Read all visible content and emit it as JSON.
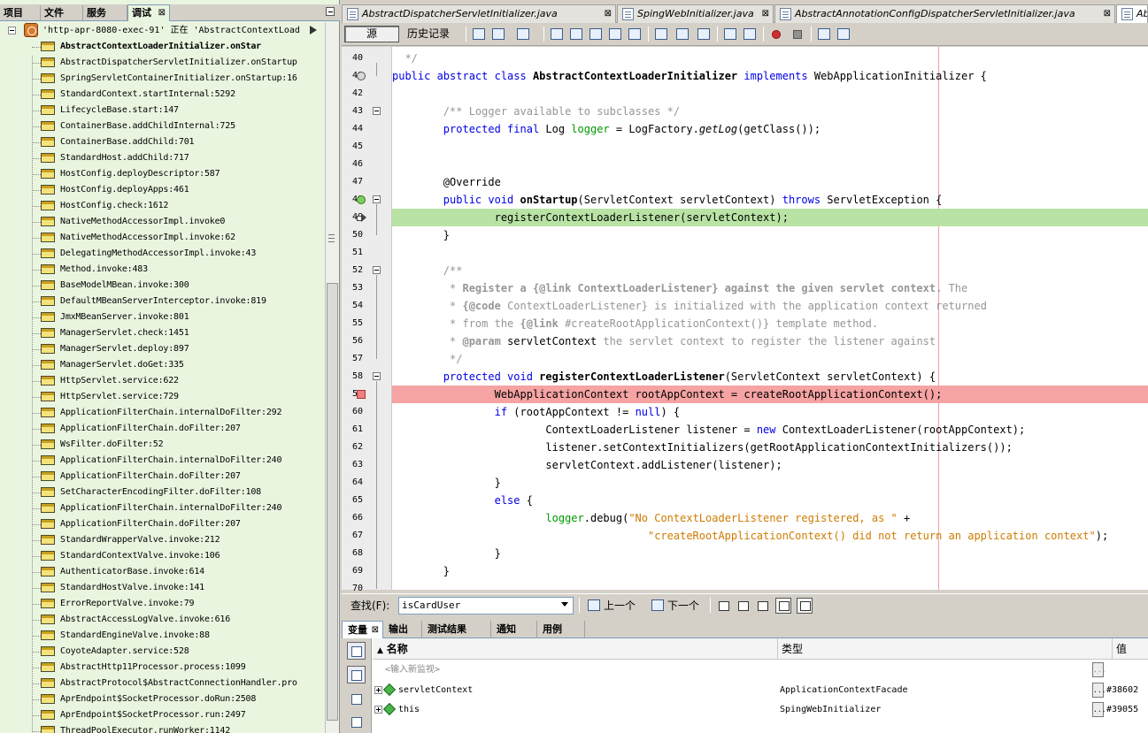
{
  "left_panel": {
    "tabs": [
      "项目",
      "文件",
      "服务",
      "调试"
    ],
    "active_tab": "调试",
    "thread_label": "'http-apr-8080-exec-91' 正在 'AbstractContextLoad",
    "frames": [
      "AbstractContextLoaderInitializer.onStar",
      "AbstractDispatcherServletInitializer.onStartup",
      "SpringServletContainerInitializer.onStartup:16",
      "StandardContext.startInternal:5292",
      "LifecycleBase.start:147",
      "ContainerBase.addChildInternal:725",
      "ContainerBase.addChild:701",
      "StandardHost.addChild:717",
      "HostConfig.deployDescriptor:587",
      "HostConfig.deployApps:461",
      "HostConfig.check:1612",
      "NativeMethodAccessorImpl.invoke0",
      "NativeMethodAccessorImpl.invoke:62",
      "DelegatingMethodAccessorImpl.invoke:43",
      "Method.invoke:483",
      "BaseModelMBean.invoke:300",
      "DefaultMBeanServerInterceptor.invoke:819",
      "JmxMBeanServer.invoke:801",
      "ManagerServlet.check:1451",
      "ManagerServlet.deploy:897",
      "ManagerServlet.doGet:335",
      "HttpServlet.service:622",
      "HttpServlet.service:729",
      "ApplicationFilterChain.internalDoFilter:292",
      "ApplicationFilterChain.doFilter:207",
      "WsFilter.doFilter:52",
      "ApplicationFilterChain.internalDoFilter:240",
      "ApplicationFilterChain.doFilter:207",
      "SetCharacterEncodingFilter.doFilter:108",
      "ApplicationFilterChain.internalDoFilter:240",
      "ApplicationFilterChain.doFilter:207",
      "StandardWrapperValve.invoke:212",
      "StandardContextValve.invoke:106",
      "AuthenticatorBase.invoke:614",
      "StandardHostValve.invoke:141",
      "ErrorReportValve.invoke:79",
      "AbstractAccessLogValve.invoke:616",
      "StandardEngineValve.invoke:88",
      "CoyoteAdapter.service:528",
      "AbstractHttp11Processor.process:1099",
      "AbstractProtocol$AbstractConnectionHandler.pro",
      "AprEndpoint$SocketProcessor.doRun:2508",
      "AprEndpoint$SocketProcessor.run:2497",
      "ThreadPoolExecutor.runWorker:1142"
    ]
  },
  "editor": {
    "tabs": [
      "AbstractDispatcherServletInitializer.java",
      "SpingWebInitializer.java",
      "AbstractAnnotationConfigDispatcherServletInitializer.java",
      "Ab"
    ],
    "source_label": "源",
    "history_label": "历史记录",
    "line_numbers": [
      "40",
      "41",
      "42",
      "43",
      "44",
      "45",
      "46",
      "47",
      "48",
      "49",
      "50",
      "51",
      "52",
      "53",
      "54",
      "55",
      "56",
      "57",
      "58",
      "59",
      "60",
      "61",
      "62",
      "63",
      "64",
      "65",
      "66",
      "67",
      "68",
      "69",
      "70"
    ],
    "lines": [
      {
        "s": [
          [
            "cm",
            "  */"
          ]
        ]
      },
      {
        "s": [
          [
            "kw",
            "public abstract class "
          ],
          [
            "bold",
            "AbstractContextLoaderInitializer"
          ],
          [
            "kw",
            " implements "
          ],
          [
            "",
            "WebApplicationInitializer {"
          ]
        ]
      },
      {
        "s": [
          [
            "",
            ""
          ]
        ]
      },
      {
        "s": [
          [
            "cm",
            "        /** Logger available to subclasses */"
          ]
        ]
      },
      {
        "s": [
          [
            "kw",
            "        protected final "
          ],
          [
            "",
            "Log "
          ],
          [
            "fld",
            "logger"
          ],
          [
            "",
            " = LogFactory."
          ],
          [
            "it",
            "getLog"
          ],
          [
            "",
            "(getClass());"
          ]
        ]
      },
      {
        "s": [
          [
            "",
            ""
          ]
        ]
      },
      {
        "s": [
          [
            "",
            ""
          ]
        ]
      },
      {
        "s": [
          [
            "",
            "        @Override"
          ]
        ]
      },
      {
        "s": [
          [
            "kw",
            "        public void "
          ],
          [
            "bold",
            "onStartup"
          ],
          [
            "",
            "(ServletContext servletContext) "
          ],
          [
            "kw",
            "throws "
          ],
          [
            "",
            "ServletException {"
          ]
        ]
      },
      {
        "hl": "green",
        "s": [
          [
            "",
            "                registerContextLoaderListener(servletContext);"
          ]
        ]
      },
      {
        "s": [
          [
            "",
            "        }"
          ]
        ]
      },
      {
        "s": [
          [
            "",
            ""
          ]
        ]
      },
      {
        "s": [
          [
            "cm",
            "        /**"
          ]
        ]
      },
      {
        "s": [
          [
            "cm",
            "         * "
          ],
          [
            "cmb",
            "Register a {@link ContextLoaderListener} against the given servlet context."
          ],
          [
            "cm",
            " The"
          ]
        ]
      },
      {
        "s": [
          [
            "cm",
            "         * "
          ],
          [
            "cmb",
            "{@code"
          ],
          [
            "cm",
            " ContextLoaderListener} is initialized with the application context returned"
          ]
        ]
      },
      {
        "s": [
          [
            "cm",
            "         * from the "
          ],
          [
            "cmb",
            "{@link"
          ],
          [
            "cm",
            " #createRootApplicationContext()} template method."
          ]
        ]
      },
      {
        "s": [
          [
            "cm",
            "         * "
          ],
          [
            "cmb",
            "@param"
          ],
          [
            "",
            " servletContext"
          ],
          [
            "cm",
            " the servlet context to register the listener against"
          ]
        ]
      },
      {
        "s": [
          [
            "cm",
            "         */"
          ]
        ]
      },
      {
        "s": [
          [
            "kw",
            "        protected void "
          ],
          [
            "bold",
            "registerContextLoaderListener"
          ],
          [
            "",
            "(ServletContext servletContext) {"
          ]
        ]
      },
      {
        "hl": "red",
        "s": [
          [
            "",
            "                WebApplicationContext rootAppContext = createRootApplicationContext();"
          ]
        ]
      },
      {
        "s": [
          [
            "kw",
            "                if "
          ],
          [
            "",
            "(rootAppContext != "
          ],
          [
            "kw",
            "null"
          ],
          [
            "",
            ") {"
          ]
        ]
      },
      {
        "s": [
          [
            "",
            "                        ContextLoaderListener listener = "
          ],
          [
            "kw",
            "new "
          ],
          [
            "",
            "ContextLoaderListener(rootAppContext);"
          ]
        ]
      },
      {
        "s": [
          [
            "",
            "                        listener.setContextInitializers(getRootApplicationContextInitializers());"
          ]
        ]
      },
      {
        "s": [
          [
            "",
            "                        servletContext.addListener(listener);"
          ]
        ]
      },
      {
        "s": [
          [
            "",
            "                }"
          ]
        ]
      },
      {
        "s": [
          [
            "kw",
            "                else "
          ],
          [
            "",
            "{"
          ]
        ]
      },
      {
        "s": [
          [
            "fld",
            "                        logger"
          ],
          [
            "",
            ".debug("
          ],
          [
            "str",
            "\"No ContextLoaderListener registered, as \""
          ],
          [
            "",
            " +"
          ]
        ]
      },
      {
        "s": [
          [
            "str",
            "                                        \"createRootApplicationContext() did not return an application context\""
          ],
          [
            "",
            ");"
          ]
        ]
      },
      {
        "s": [
          [
            "",
            "                }"
          ]
        ]
      },
      {
        "s": [
          [
            "",
            "        }"
          ]
        ]
      },
      {
        "s": [
          [
            "",
            ""
          ]
        ]
      }
    ]
  },
  "find": {
    "label": "查找(F):",
    "value": "isCardUser",
    "prev_label": "上一个",
    "next_label": "下一个"
  },
  "bottom": {
    "tabs": [
      "变量",
      "输出",
      "测试结果",
      "通知",
      "用例"
    ],
    "active_tab": "变量",
    "col_name": "名称",
    "col_type": "类型",
    "col_value": "值",
    "new_watch": "<输入新监视>",
    "rows": [
      {
        "name": "servletContext",
        "type": "ApplicationContextFacade",
        "value": "#38602"
      },
      {
        "name": "this",
        "type": "SpingWebInitializer",
        "value": "#39055"
      }
    ]
  }
}
